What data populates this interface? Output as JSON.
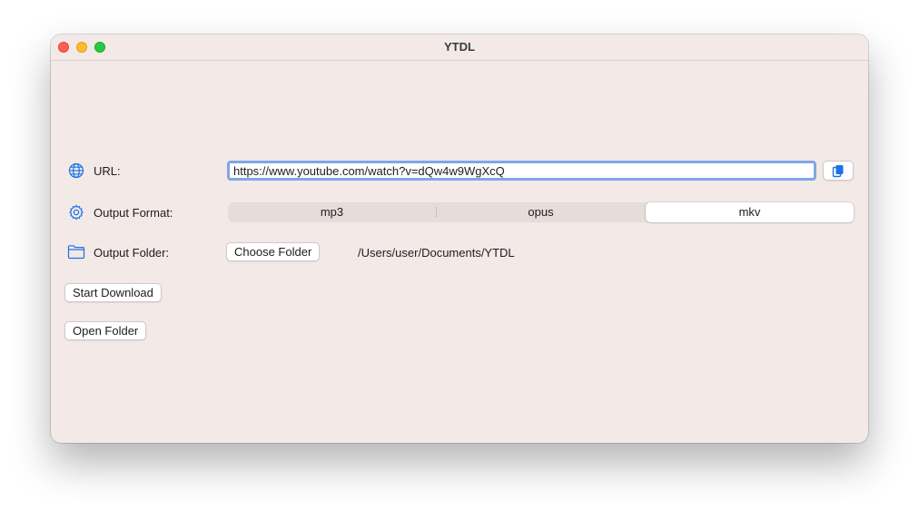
{
  "window": {
    "title": "YTDL"
  },
  "url_row": {
    "label": "URL:",
    "icon": "globe-icon",
    "value": "https://www.youtube.com/watch?v=dQw4w9WgXcQ",
    "paste_icon": "clipboard-icon"
  },
  "format_row": {
    "label": "Output Format:",
    "icon": "gear-icon",
    "options": [
      "mp3",
      "opus",
      "mkv"
    ],
    "selected": "mkv"
  },
  "folder_row": {
    "label": "Output Folder:",
    "icon": "folder-icon",
    "choose_label": "Choose Folder",
    "path": "/Users/user/Documents/YTDL"
  },
  "actions": {
    "start_label": "Start Download",
    "open_label": "Open Folder"
  },
  "colors": {
    "accent": "#1a73e8",
    "focus_ring": "#7fa7e6",
    "window_bg": "#f3e9e7"
  }
}
